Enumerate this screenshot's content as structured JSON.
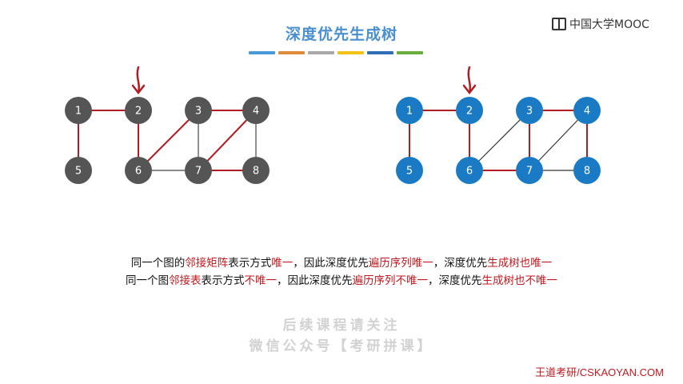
{
  "header": {
    "title": "深度优先生成树",
    "logo_text": "中国大学MOOC",
    "accent_colors": [
      "#4a9ad8",
      "#e08a3c",
      "#a8a8a8",
      "#f2c21b",
      "#2f6db5",
      "#6aad3d"
    ]
  },
  "left_graph": {
    "node_color": "#555555",
    "edge_color": "#444444",
    "highlight_color": "#b01e23",
    "nodes": [
      {
        "id": "1"
      },
      {
        "id": "2"
      },
      {
        "id": "3"
      },
      {
        "id": "4"
      },
      {
        "id": "5"
      },
      {
        "id": "6"
      },
      {
        "id": "7"
      },
      {
        "id": "8"
      }
    ],
    "edges": [
      {
        "from": "1",
        "to": "2",
        "tree": true
      },
      {
        "from": "1",
        "to": "5",
        "tree": true
      },
      {
        "from": "2",
        "to": "6",
        "tree": true
      },
      {
        "from": "6",
        "to": "3",
        "tree": true
      },
      {
        "from": "3",
        "to": "4",
        "tree": true
      },
      {
        "from": "4",
        "to": "7",
        "tree": true
      },
      {
        "from": "7",
        "to": "8",
        "tree": true
      },
      {
        "from": "3",
        "to": "7",
        "tree": false
      },
      {
        "from": "4",
        "to": "8",
        "tree": false
      },
      {
        "from": "6",
        "to": "7",
        "tree": false
      }
    ],
    "start_node": "2"
  },
  "right_graph": {
    "node_color": "#1a7bc4",
    "edge_color": "#333333",
    "highlight_color": "#b01e23",
    "nodes": [
      {
        "id": "1"
      },
      {
        "id": "2"
      },
      {
        "id": "3"
      },
      {
        "id": "4"
      },
      {
        "id": "5"
      },
      {
        "id": "6"
      },
      {
        "id": "7"
      },
      {
        "id": "8"
      }
    ],
    "edges": [
      {
        "from": "1",
        "to": "2",
        "tree": true
      },
      {
        "from": "1",
        "to": "5",
        "tree": true
      },
      {
        "from": "2",
        "to": "6",
        "tree": true
      },
      {
        "from": "6",
        "to": "7",
        "tree": true
      },
      {
        "from": "7",
        "to": "3",
        "tree": true
      },
      {
        "from": "3",
        "to": "4",
        "tree": true
      },
      {
        "from": "4",
        "to": "8",
        "tree": true
      },
      {
        "from": "6",
        "to": "3",
        "tree": false
      },
      {
        "from": "7",
        "to": "4",
        "tree": false
      },
      {
        "from": "7",
        "to": "8",
        "tree": false
      }
    ],
    "start_node": "2"
  },
  "notes": {
    "line1": [
      {
        "text": "同一个图的",
        "red": false
      },
      {
        "text": "邻接矩阵",
        "red": true
      },
      {
        "text": "表示方式",
        "red": false
      },
      {
        "text": "唯一",
        "red": true
      },
      {
        "text": "，因此深度优先",
        "red": false
      },
      {
        "text": "遍历序列唯一",
        "red": true
      },
      {
        "text": "，深度优先",
        "red": false
      },
      {
        "text": "生成树也唯一",
        "red": true
      }
    ],
    "line2": [
      {
        "text": "同一个图",
        "red": false
      },
      {
        "text": "邻接表",
        "red": true
      },
      {
        "text": "表示方式",
        "red": false
      },
      {
        "text": "不唯一",
        "red": true
      },
      {
        "text": "，因此深度优先",
        "red": false
      },
      {
        "text": "遍历序列不唯一",
        "red": true
      },
      {
        "text": "，深度优先",
        "red": false
      },
      {
        "text": "生成树也不唯一",
        "red": true
      }
    ]
  },
  "watermark": {
    "line1": "后续课程请关注",
    "line2": "微信公众号【考研拼课】"
  },
  "footer": {
    "text": "王道考研/CSKAOYAN.COM"
  }
}
